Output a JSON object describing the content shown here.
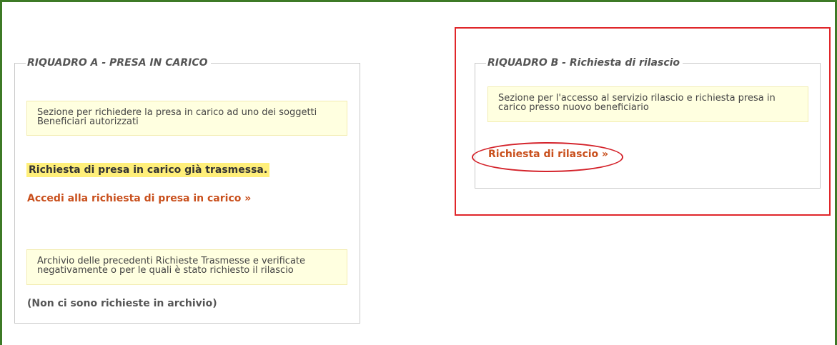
{
  "panel_a": {
    "legend": "RIQUADRO A - PRESA IN CARICO",
    "intro_note": "Sezione per richiedere la presa in carico ad uno dei soggetti Beneficiari autorizzati",
    "status_text": "Richiesta di presa in carico già trasmessa.",
    "access_link": "Accedi alla richiesta di presa in carico »",
    "archive_note": "Archivio delle precedenti Richieste Trasmesse e verificate negativamente o per le quali è stato richiesto il rilascio",
    "archive_empty": "(Non ci sono richieste in archivio)"
  },
  "panel_b": {
    "legend": "RIQUADRO B - Richiesta di rilascio",
    "intro_note": "Sezione per l'accesso al servizio rilascio e richiesta presa in carico presso nuovo beneficiario",
    "release_link": "Richiesta di rilascio »"
  },
  "colors": {
    "frame_green": "#3d7a26",
    "link_orange": "#c9501d",
    "annotation_red": "#e0262a",
    "note_background": "#ffffe0",
    "status_highlight": "#ffef7a"
  }
}
